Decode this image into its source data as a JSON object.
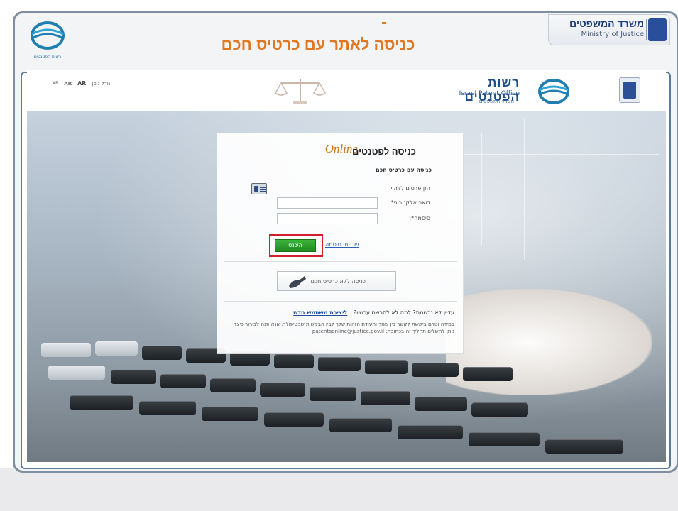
{
  "slide": {
    "title": "כניסה לאתר עם כרטיס חכם",
    "ministry_hebrew": "משרד המשפטים",
    "ministry_english": "Ministry of Justice",
    "logo_caption": "רשות הפטנטים"
  },
  "site_header": {
    "font_size_label": "גודל גופן",
    "font_size_options": [
      "AR",
      "AR",
      "AR"
    ],
    "brand_hebrew": "רשות הפטנטים",
    "brand_english": "Israel Patent Office",
    "brand_sub": "משרד המשפטים"
  },
  "login": {
    "title": "כניסה לפטנטים",
    "online_word": "Online",
    "subtitle": "כניסה עם כרטיס חכם",
    "id_label": "הזן פרטים לזיהוי:",
    "email_label": "דואר אלקטרוני*:",
    "password_label": "סיסמה*:",
    "email_value": "",
    "password_value": "",
    "submit_label": "היכנס",
    "forgot_password": "שכחתי סיסמה",
    "no_card_button": "כניסה ללא כרטיס חכם",
    "register_question": "עדיין לא נרשמת? למה לא להרשם עכשיו?",
    "register_link": "ליצירת משתמש חדש",
    "help_text": "במידה וטרם ביקשת לקשר בין שמך ותעודת הזהות שלך לבין הבקשות שבטיפולך, אנא פנה לבירור כיצד ניתן להשלים תהליך זה בכתובת:",
    "help_email": "patentsonline@justice.gov.il"
  }
}
